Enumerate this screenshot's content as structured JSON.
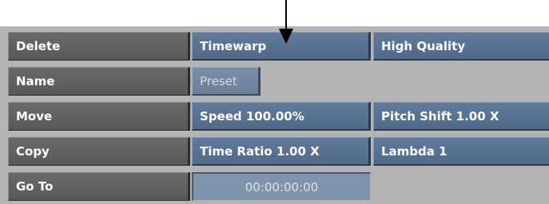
{
  "left_buttons": {
    "delete": "Delete",
    "name": "Name",
    "move": "Move",
    "copy": "Copy",
    "goto": "Go To"
  },
  "fields": {
    "timewarp": "Timewarp",
    "high_quality": "High Quality",
    "preset": "Preset",
    "speed": "Speed 100.00%",
    "pitch_shift": "Pitch Shift 1.00 X",
    "time_ratio": "Time Ratio 1.00 X",
    "lambda": "Lambda 1",
    "timecode": "00:00:00:00"
  },
  "icons": {
    "pointer": "down-arrow-icon"
  },
  "colors": {
    "panel": "#b4b4b4",
    "gray_button": "#606060",
    "blue_button": "#587290",
    "text": "#ffffff"
  }
}
